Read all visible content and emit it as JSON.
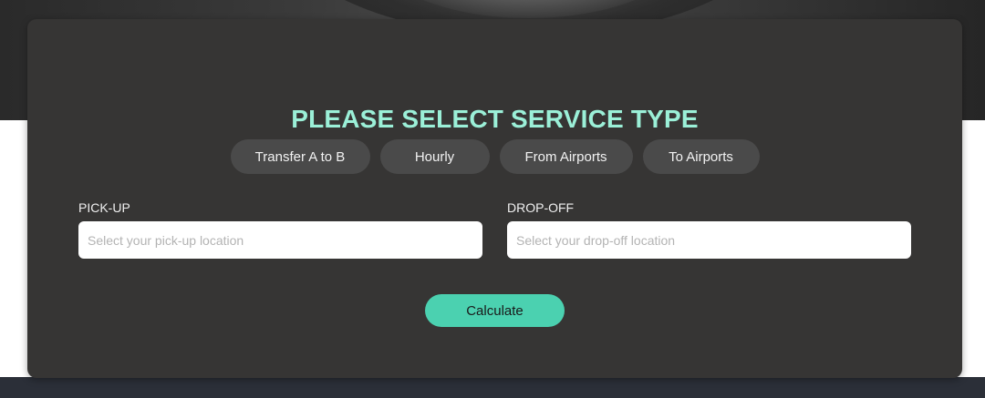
{
  "form": {
    "title": "PLEASE SELECT SERVICE TYPE",
    "service_types": [
      {
        "label": "Transfer A to B"
      },
      {
        "label": "Hourly"
      },
      {
        "label": "From Airports"
      },
      {
        "label": "To Airports"
      }
    ],
    "pickup": {
      "label": "PICK-UP",
      "placeholder": "Select your pick-up location",
      "value": ""
    },
    "dropoff": {
      "label": "DROP-OFF",
      "placeholder": "Select your drop-off location",
      "value": ""
    },
    "calculate_label": "Calculate"
  },
  "colors": {
    "title": "#9bf0d8",
    "accent": "#4bd1b0",
    "card": "#363534",
    "service_button": "#4a4a4a"
  }
}
